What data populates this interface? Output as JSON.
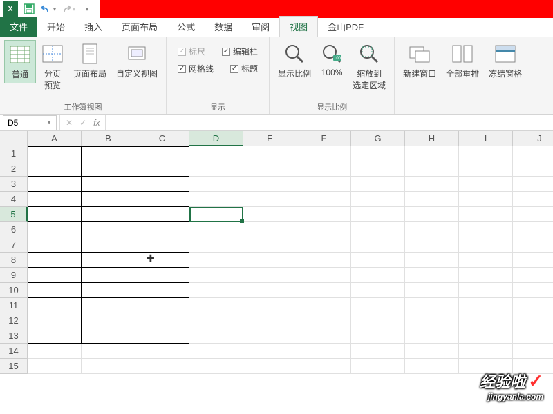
{
  "qat": {
    "save_title": "保存",
    "undo_title": "撤销",
    "redo_title": "重做"
  },
  "tabs": {
    "file": "文件",
    "home": "开始",
    "insert": "插入",
    "layout": "页面布局",
    "formula": "公式",
    "data": "数据",
    "review": "审阅",
    "view": "视图",
    "pdf": "金山PDF"
  },
  "ribbon": {
    "views": {
      "normal": "普通",
      "pagebreak_l1": "分页",
      "pagebreak_l2": "预览",
      "pagelayout": "页面布局",
      "custom": "自定义视图",
      "group": "工作簿视图"
    },
    "show": {
      "ruler": "标尺",
      "formula_bar": "编辑栏",
      "gridlines": "网格线",
      "headings": "标题",
      "group": "显示"
    },
    "zoom": {
      "zoom": "显示比例",
      "hundred": "100%",
      "to_sel_l1": "缩放到",
      "to_sel_l2": "选定区域",
      "group": "显示比例"
    },
    "window": {
      "new": "新建窗口",
      "arrange": "全部重排",
      "freeze": "冻结窗格"
    }
  },
  "formula_bar": {
    "cell_ref": "D5",
    "fx": "fx",
    "value": ""
  },
  "columns": [
    "A",
    "B",
    "C",
    "D",
    "E",
    "F",
    "G",
    "H",
    "I",
    "J"
  ],
  "rows": [
    "1",
    "2",
    "3",
    "4",
    "5",
    "6",
    "7",
    "8",
    "9",
    "10",
    "11",
    "12",
    "13",
    "14",
    "15"
  ],
  "selected": {
    "col": "D",
    "row": "5"
  },
  "watermark": {
    "brand": "经验啦",
    "url": "jingyanla.com"
  }
}
